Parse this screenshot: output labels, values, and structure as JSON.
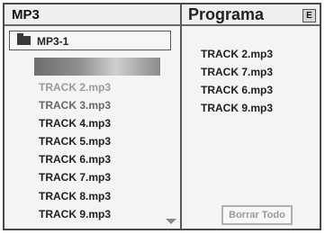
{
  "browser": {
    "title": "MP3",
    "folder": {
      "label": "MP3-1",
      "icon": "folder-icon"
    },
    "tracks": [
      "TRACK 2.mp3",
      "TRACK 3.mp3",
      "TRACK 4.mp3",
      "TRACK 5.mp3",
      "TRACK 6.mp3",
      "TRACK 7.mp3",
      "TRACK 8.mp3",
      "TRACK 9.mp3"
    ]
  },
  "program": {
    "title": "Programa",
    "badge": "E",
    "tracks": [
      "TRACK 2.mp3",
      "TRACK 7.mp3",
      "TRACK 6.mp3",
      "TRACK 9.mp3"
    ],
    "clear_button": "Borrar Todo"
  }
}
